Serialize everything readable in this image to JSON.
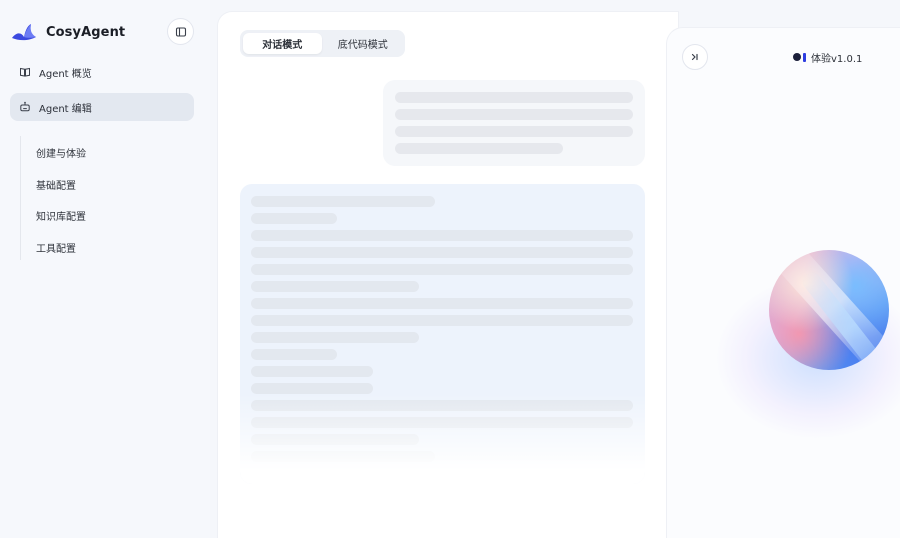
{
  "app": {
    "name": "CosyAgent"
  },
  "sidebar": {
    "items": [
      {
        "label": "Agent 概览",
        "icon": "book-icon",
        "active": false
      },
      {
        "label": "Agent 编辑",
        "icon": "robot-icon",
        "active": true
      }
    ],
    "sub_items": [
      {
        "label": "创建与体验"
      },
      {
        "label": "基础配置"
      },
      {
        "label": "知识库配置"
      },
      {
        "label": "工具配置"
      }
    ]
  },
  "main": {
    "mode_tabs": [
      {
        "label": "对话模式",
        "active": true
      },
      {
        "label": "底代码模式",
        "active": false
      }
    ]
  },
  "preview": {
    "version_label": "体验v1.0.1"
  },
  "colors": {
    "accent": "#2d3de0",
    "active_nav_bg": "#e3e8f0",
    "bot_bubble_bg": "#edf3fc"
  }
}
